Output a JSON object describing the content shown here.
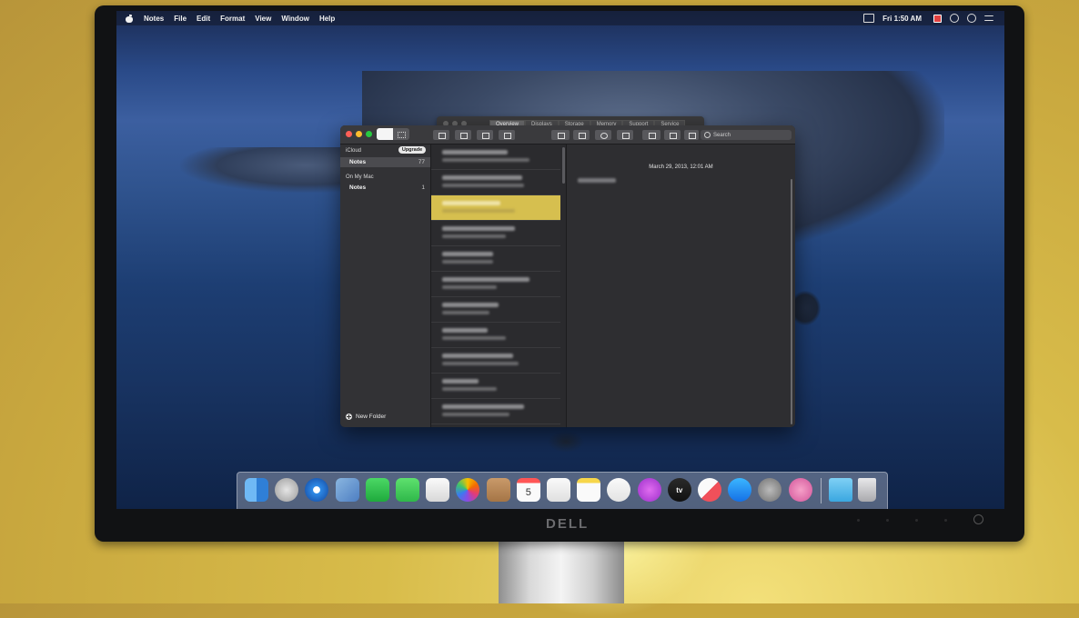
{
  "menubar": {
    "app_name": "Notes",
    "items": [
      "File",
      "Edit",
      "Format",
      "View",
      "Window",
      "Help"
    ],
    "clock": "Fri 1:50 AM"
  },
  "system_info_window": {
    "tabs": [
      "Overview",
      "Displays",
      "Storage",
      "Memory",
      "Support",
      "Service"
    ],
    "active_tab": "Overview"
  },
  "notes_window": {
    "search_placeholder": "Search",
    "sidebar": {
      "icloud_header": "iCloud",
      "upgrade_label": "Upgrade",
      "icloud_folder": {
        "label": "Notes",
        "count": "77"
      },
      "mac_header": "On My Mac",
      "mac_folder": {
        "label": "Notes",
        "count": "1"
      },
      "new_folder_label": "New Folder"
    },
    "selected_note_index": 2,
    "note_count_visible": 11,
    "editor": {
      "date": "March 29, 2013, 12:01 AM"
    }
  },
  "dock": {
    "apps": [
      "finder-icon",
      "launchpad-icon",
      "safari-icon",
      "preview-icon",
      "facetime-icon",
      "messages-icon",
      "textedit-icon",
      "photos-icon",
      "contacts-icon",
      "calendar-icon",
      "reminders-icon",
      "notes-icon",
      "music-icon",
      "podcasts-icon",
      "tv-icon",
      "news-icon",
      "app-store-icon",
      "system-preferences-icon",
      "feedback-icon"
    ],
    "calendar_day": "5",
    "tv_label": "tv",
    "downloads": "downloads-folder-icon",
    "trash": "trash-icon"
  },
  "monitor_brand": "DELL",
  "colors": {
    "wall": "#c8a73e",
    "note_highlight": "#d6bf4f",
    "window_bg": "#2a2a2d"
  }
}
